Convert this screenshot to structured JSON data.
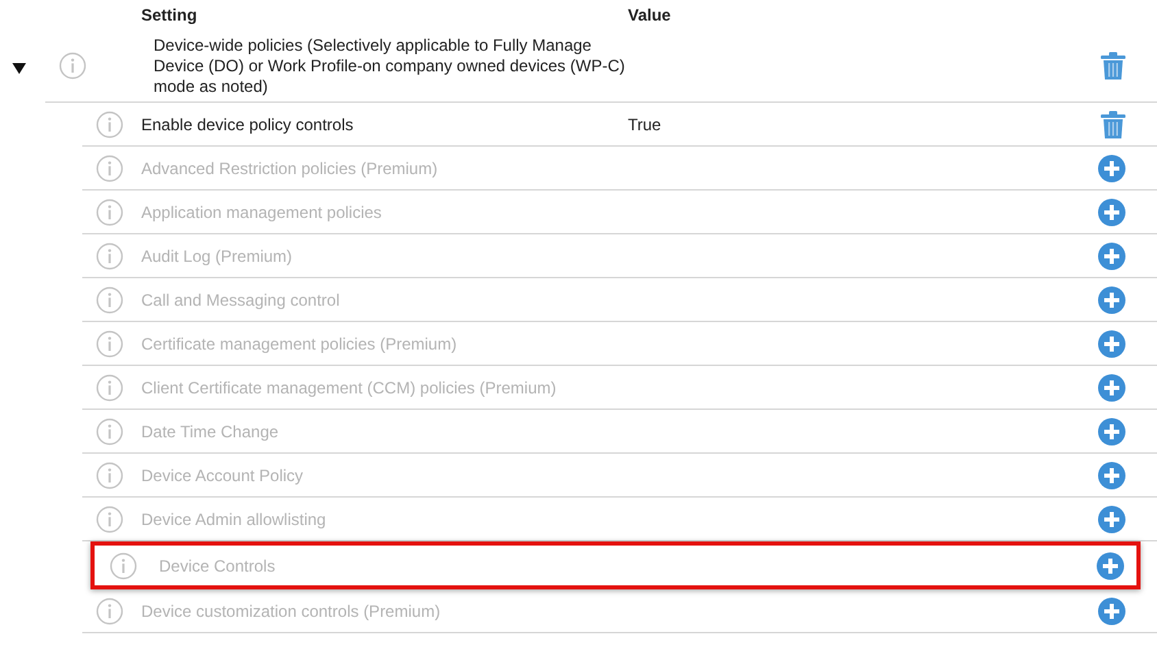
{
  "columns": [
    "Setting",
    "Value"
  ],
  "group": {
    "label": "Device-wide policies (Selectively applicable to Fully Manage Device (DO) or Work Profile-on company owned devices (WP-C) mode as noted)",
    "expanded": true,
    "rows": [
      {
        "label": "Enable device policy controls",
        "value": "True",
        "enabled": true,
        "highlighted": false
      },
      {
        "label": "Advanced Restriction policies (Premium)",
        "enabled": false,
        "highlighted": false
      },
      {
        "label": "Application management policies",
        "enabled": false,
        "highlighted": false
      },
      {
        "label": "Audit Log (Premium)",
        "enabled": false,
        "highlighted": false
      },
      {
        "label": "Call and Messaging control",
        "enabled": false,
        "highlighted": false
      },
      {
        "label": "Certificate management policies (Premium)",
        "enabled": false,
        "highlighted": false
      },
      {
        "label": "Client Certificate management (CCM) policies (Premium)",
        "enabled": false,
        "highlighted": false
      },
      {
        "label": "Date Time Change",
        "enabled": false,
        "highlighted": false
      },
      {
        "label": "Device Account Policy",
        "enabled": false,
        "highlighted": false
      },
      {
        "label": "Device Admin allowlisting",
        "enabled": false,
        "highlighted": false
      },
      {
        "label": "Device Controls",
        "enabled": false,
        "highlighted": true
      },
      {
        "label": "Device customization controls (Premium)",
        "enabled": false,
        "highlighted": false
      }
    ]
  }
}
